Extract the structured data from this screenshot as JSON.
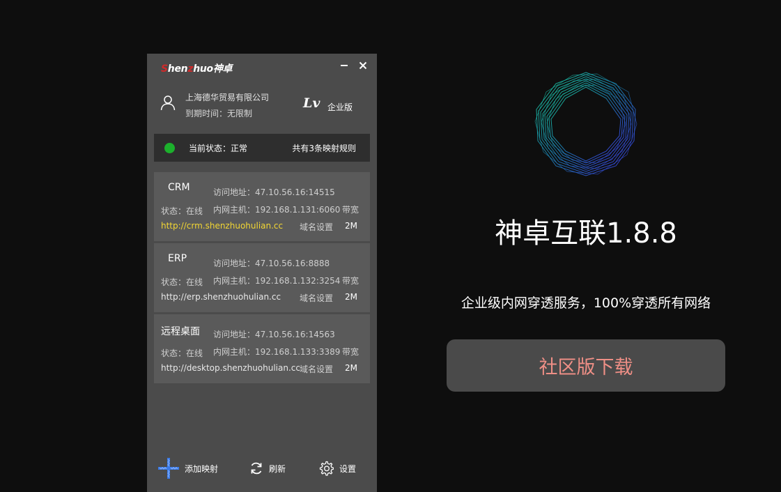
{
  "app": {
    "logo_prefix": "S",
    "logo_mid1": "hen",
    "logo_z": "z",
    "logo_mid2": "huo",
    "logo_cn": "神卓",
    "window_controls": {
      "minimize": "−",
      "close": "✕"
    }
  },
  "account": {
    "company": "上海德华贸易有限公司",
    "expiry": "到期时间：无限制",
    "level_mark": "Lv",
    "edition": "企业版"
  },
  "status": {
    "text": "当前状态：正常",
    "rule_count": "共有3条映射规则",
    "color": "#1cb02c"
  },
  "mappings": [
    {
      "name": "CRM",
      "access": "访问地址：47.10.56.16:14515",
      "state": "状态：在线",
      "host": "内网主机：192.168.1.131:6060",
      "bandwidth_label": "带宽",
      "url": "http://crm.shenzhuohulian.cc",
      "domain_settings": "域名设置",
      "bandwidth": "2M"
    },
    {
      "name": "ERP",
      "access": "访问地址：47.10.56.16:8888",
      "state": "状态：在线",
      "host": "内网主机：192.168.1.132:3254",
      "bandwidth_label": "带宽",
      "url": "http://erp.shenzhuohulian.cc",
      "domain_settings": "域名设置",
      "bandwidth": "2M"
    },
    {
      "name": "远程桌面",
      "access": "访问地址：47.10.56.16:14563",
      "state": "状态：在线",
      "host": "内网主机：192.168.1.133:3389",
      "bandwidth_label": "带宽",
      "url": "http://desktop.shenzhuohulian.cc",
      "domain_settings": "域名设置",
      "bandwidth": "2M"
    }
  ],
  "toolbar": {
    "add": "添加映射",
    "refresh": "刷新",
    "settings": "设置"
  },
  "promo": {
    "title": "神卓互联1.8.8",
    "tagline": "企业级内网穿透服务，100%穿透所有网络",
    "download": "社区版下载"
  },
  "colors": {
    "background": "#0e0e0e",
    "panel": "#4b4b4b",
    "card": "#5a5a5a",
    "highlight_url": "#f2d633",
    "download_text": "#ef8f86",
    "logo_red": "#d12a2a"
  },
  "icons": {
    "user": "user-icon",
    "add": "plus-icon",
    "refresh": "refresh-icon",
    "settings": "gear-icon",
    "logo_ring": "ring-logo-icon"
  }
}
